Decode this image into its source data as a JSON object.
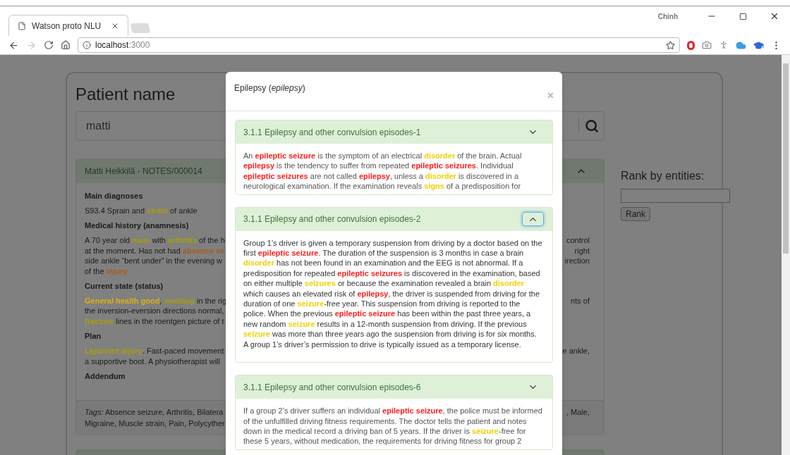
{
  "browser": {
    "tab": {
      "title": "Watson proto NLU"
    },
    "profile": "Chinh",
    "address": {
      "host": "localhost",
      "port": ":3000"
    }
  },
  "page": {
    "heading": "Patient name",
    "search": {
      "value": "matti"
    },
    "note": {
      "title": "Matti Heikkilä - NOTES/000014",
      "expanded": true,
      "sections": [
        {
          "heading": "Main diagnoses",
          "lines": [
            {
              "left": [
                {
                  "text": "S93.4 Sprain and "
                },
                {
                  "text": "strain",
                  "color": "#a89c0c"
                },
                {
                  "text": " of ankle"
                }
              ]
            }
          ]
        },
        {
          "heading": "Medical history (anamnesis)",
          "lines": [
            {
              "left": [
                {
                  "text": "A 70 year old "
                },
                {
                  "text": "male",
                  "color": "#a89c0c"
                },
                {
                  "text": " with "
                },
                {
                  "text": "arthritis",
                  "color": "#a89c0c"
                },
                {
                  "text": " of the h"
                }
              ],
              "right": "control"
            },
            {
              "left": [
                {
                  "text": "at the moment. Has not had "
                },
                {
                  "text": "absence se",
                  "color": "#a85a1e"
                }
              ],
              "right": "right"
            },
            {
              "left": [
                {
                  "text": "side ankle “bent under” in the evening w"
                }
              ],
              "right": "irection"
            },
            {
              "left": [
                {
                  "text": "of the "
                },
                {
                  "text": "injury",
                  "color": "#a85a1e"
                }
              ]
            }
          ]
        },
        {
          "heading": "Current state (status)",
          "lines": [
            {
              "left": [
                {
                  "text": "General health good",
                  "color": "#dcb010"
                },
                {
                  "text": ", "
                },
                {
                  "text": "swelling",
                  "color": "#a89c0c"
                },
                {
                  "text": " in the rig"
                }
              ],
              "right": "nts of"
            },
            {
              "left": [
                {
                  "text": "the inversion-eversion directions normal,"
                }
              ]
            },
            {
              "left": [
                {
                  "text": "fracture",
                  "color": "#a89c0c"
                },
                {
                  "text": " lines in the roentgen picture of t"
                }
              ]
            }
          ]
        },
        {
          "heading": "Plan",
          "lines": [
            {
              "left": [
                {
                  "text": "Ligament injury",
                  "color": "#a89c0c"
                },
                {
                  "text": ". Fast-paced movement"
                }
              ],
              "right": "e ankle,"
            },
            {
              "left": [
                {
                  "text": "a supportive boot. A physiotherapist will"
                }
              ]
            }
          ]
        },
        {
          "heading": "Addendum"
        }
      ],
      "tags": [
        {
          "left": "*Tags:* Absence seizure, Arthritis, Bilatera",
          "right": ", Male,"
        },
        {
          "left": "Migraine, Muscle strain, Pain, Polycyther"
        }
      ]
    },
    "rank": {
      "label": "Rank by entities:",
      "button": "Rank"
    }
  },
  "modal": {
    "title": "Epilepsy (*epilepsy*)",
    "close": "×",
    "panels": [
      {
        "title": "3.1.1 Epilepsy and other convulsion episodes-1",
        "expanded": false,
        "focused": false,
        "segments": [
          {
            "text": "An "
          },
          {
            "text": "epileptic seizure",
            "color": "#ff1a1a"
          },
          {
            "text": " is the symptom of an electrical "
          },
          {
            "text": "disorder",
            "color": "#f0d000"
          },
          {
            "text": " of the brain. Actual "
          },
          {
            "text": "epilepsy",
            "color": "#ff1a1a"
          },
          {
            "text": " is the tendency to suffer from repeated "
          },
          {
            "text": "epileptic seizures",
            "color": "#ff1a1a"
          },
          {
            "text": ". Individual "
          },
          {
            "text": "epileptic seizures",
            "color": "#ff1a1a"
          },
          {
            "text": " are not called "
          },
          {
            "text": "epilepsy",
            "color": "#ff1a1a"
          },
          {
            "text": ", unless a "
          },
          {
            "text": "disorder",
            "color": "#f0d000"
          },
          {
            "text": " is discovered in a neurological examination. If the examination reveals "
          },
          {
            "text": "signs",
            "color": "#f0d000"
          },
          {
            "text": " of a predisposition for"
          }
        ]
      },
      {
        "title": "3.1.1 Epilepsy and other convulsion episodes-2",
        "expanded": true,
        "focused": true,
        "segments": [
          {
            "text": "Group 1’s driver is given a temporary suspension from driving by a doctor based on the first "
          },
          {
            "text": "epileptic seizure",
            "color": "#ff1a1a"
          },
          {
            "text": ". The duration of the suspension is 3 months in case a brain "
          },
          {
            "text": "disorder",
            "color": "#f0d000"
          },
          {
            "text": " has not been found in an examination and the EEG is not abnormal. If a predisposition for repeated "
          },
          {
            "text": "epileptic seizures",
            "color": "#ff1a1a"
          },
          {
            "text": " is discovered in the examination, based on either multiple "
          },
          {
            "text": "seizures",
            "color": "#f0d000"
          },
          {
            "text": " or because the examination revealed a brain "
          },
          {
            "text": "disorder",
            "color": "#f0d000"
          },
          {
            "text": " which causes an elevated risk of "
          },
          {
            "text": "epilepsy",
            "color": "#ff1a1a"
          },
          {
            "text": ", the driver is suspended from driving for the duration of one "
          },
          {
            "text": "seizure",
            "color": "#f0d000"
          },
          {
            "text": "-free year. This suspension from driving is reported to the police. When the previous "
          },
          {
            "text": "epileptic seizure",
            "color": "#ff1a1a"
          },
          {
            "text": " has been within the past three years, a new random "
          },
          {
            "text": "seizure",
            "color": "#f0d000"
          },
          {
            "text": " results in a 12-month suspension from driving. If the previous "
          },
          {
            "text": "seizure",
            "color": "#f0d000"
          },
          {
            "text": " was more than three years ago the suspension from driving is for six months. A group 1’s driver’s permission to drive is typically issued as a temporary license."
          }
        ]
      },
      {
        "title": "3.1.1 Epilepsy and other convulsion episodes-6",
        "expanded": false,
        "focused": false,
        "segments": [
          {
            "text": "If a group 2’s driver suffers an individual "
          },
          {
            "text": "epileptic seizure",
            "color": "#ff1a1a"
          },
          {
            "text": ", the police must be informed of the unfulfilled driving fitness requirements. The doctor tells the patient and notes down in the medical record a driving ban of 5 years. If the driver is "
          },
          {
            "text": "seizure",
            "color": "#f0d000"
          },
          {
            "text": "-free for these 5 years, without medication, the requirements for driving fitness for group 2"
          }
        ]
      }
    ]
  }
}
